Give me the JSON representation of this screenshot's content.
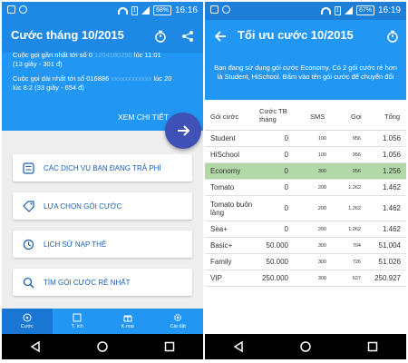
{
  "left": {
    "status": {
      "battery": "68%",
      "time": "16:16"
    },
    "title": "Cước tháng 10/2015",
    "header_lines": {
      "l1_a": "Cuộc gọi gần nhất  tới số 0",
      "l1_masked": "1204180250",
      "l1_b": "lúc 11:01",
      "l2": "(13 giây - 301 đ)",
      "l3_a": "Cuộc gọi dài nhất  tới số 016886",
      "l3_masked": "xxxxxxxxxxxx",
      "l3_b": "lúc 20",
      "l4": "lúc 8:2 (33 giây - 654 đ)"
    },
    "more_link": "XEM CHI TIẾT",
    "menu": [
      {
        "label": "CÁC DỊCH VỤ BẠN ĐANG TRẢ PHÍ"
      },
      {
        "label": "LỰA CHỌN GÓI CƯỚC"
      },
      {
        "label": "LỊCH SỬ NẠP THẺ"
      },
      {
        "label": "TÌM GÓI CƯỚC RẺ NHẤT"
      }
    ],
    "bottom_nav": [
      {
        "label": "Cước"
      },
      {
        "label": "T. ích"
      },
      {
        "label": "K.mại"
      },
      {
        "label": "Cài đặt"
      }
    ]
  },
  "right": {
    "status": {
      "battery": "67%",
      "time": "16:19"
    },
    "title": "Tối ưu cước 10/2015",
    "info": "Bạn đang sử dụng gói cước Economy. Có 2 gói cước rẻ hơn là Student, HiSchool. Bấm vào tên gói cước để chuyển đổi",
    "columns": {
      "name": "Gói cước",
      "fee_line1": "Cước TB",
      "fee_line2": "tháng",
      "sms": "SMS",
      "call": "Gọi",
      "total": "Tổng"
    },
    "rows": [
      {
        "name": "Student",
        "fee": "0",
        "sms": "100",
        "call": "956",
        "total": "1.056"
      },
      {
        "name": "HiSchool",
        "fee": "0",
        "sms": "100",
        "call": "956",
        "total": "1.056"
      },
      {
        "name": "Economy",
        "fee": "0",
        "sms": "300",
        "call": "956",
        "total": "1.256"
      },
      {
        "name": "Tomato",
        "fee": "0",
        "sms": "200",
        "call": "1.262",
        "total": "1.462"
      },
      {
        "name": "Tomato buôn làng",
        "fee": "0",
        "sms": "200",
        "call": "1.262",
        "total": "1.462"
      },
      {
        "name": "Sea+",
        "fee": "0",
        "sms": "200",
        "call": "1.262",
        "total": "1.462"
      },
      {
        "name": "Basic+",
        "fee": "50.000",
        "sms": "300",
        "call": "704",
        "total": "51.004"
      },
      {
        "name": "Family",
        "fee": "50.000",
        "sms": "300",
        "call": "726",
        "total": "51.026"
      },
      {
        "name": "VIP",
        "fee": "250.000",
        "sms": "300",
        "call": "627",
        "total": "250.927"
      }
    ]
  },
  "colors": {
    "primary": "#2196f3",
    "dark_blue": "#1976d2",
    "fab": "#3f51b5",
    "highlight": "#b2d8a8"
  },
  "icons": [
    "timer-icon",
    "share-icon",
    "arrow-back-icon",
    "arrow-right-icon",
    "list-icon",
    "tag-icon",
    "history-icon",
    "search-icon"
  ]
}
